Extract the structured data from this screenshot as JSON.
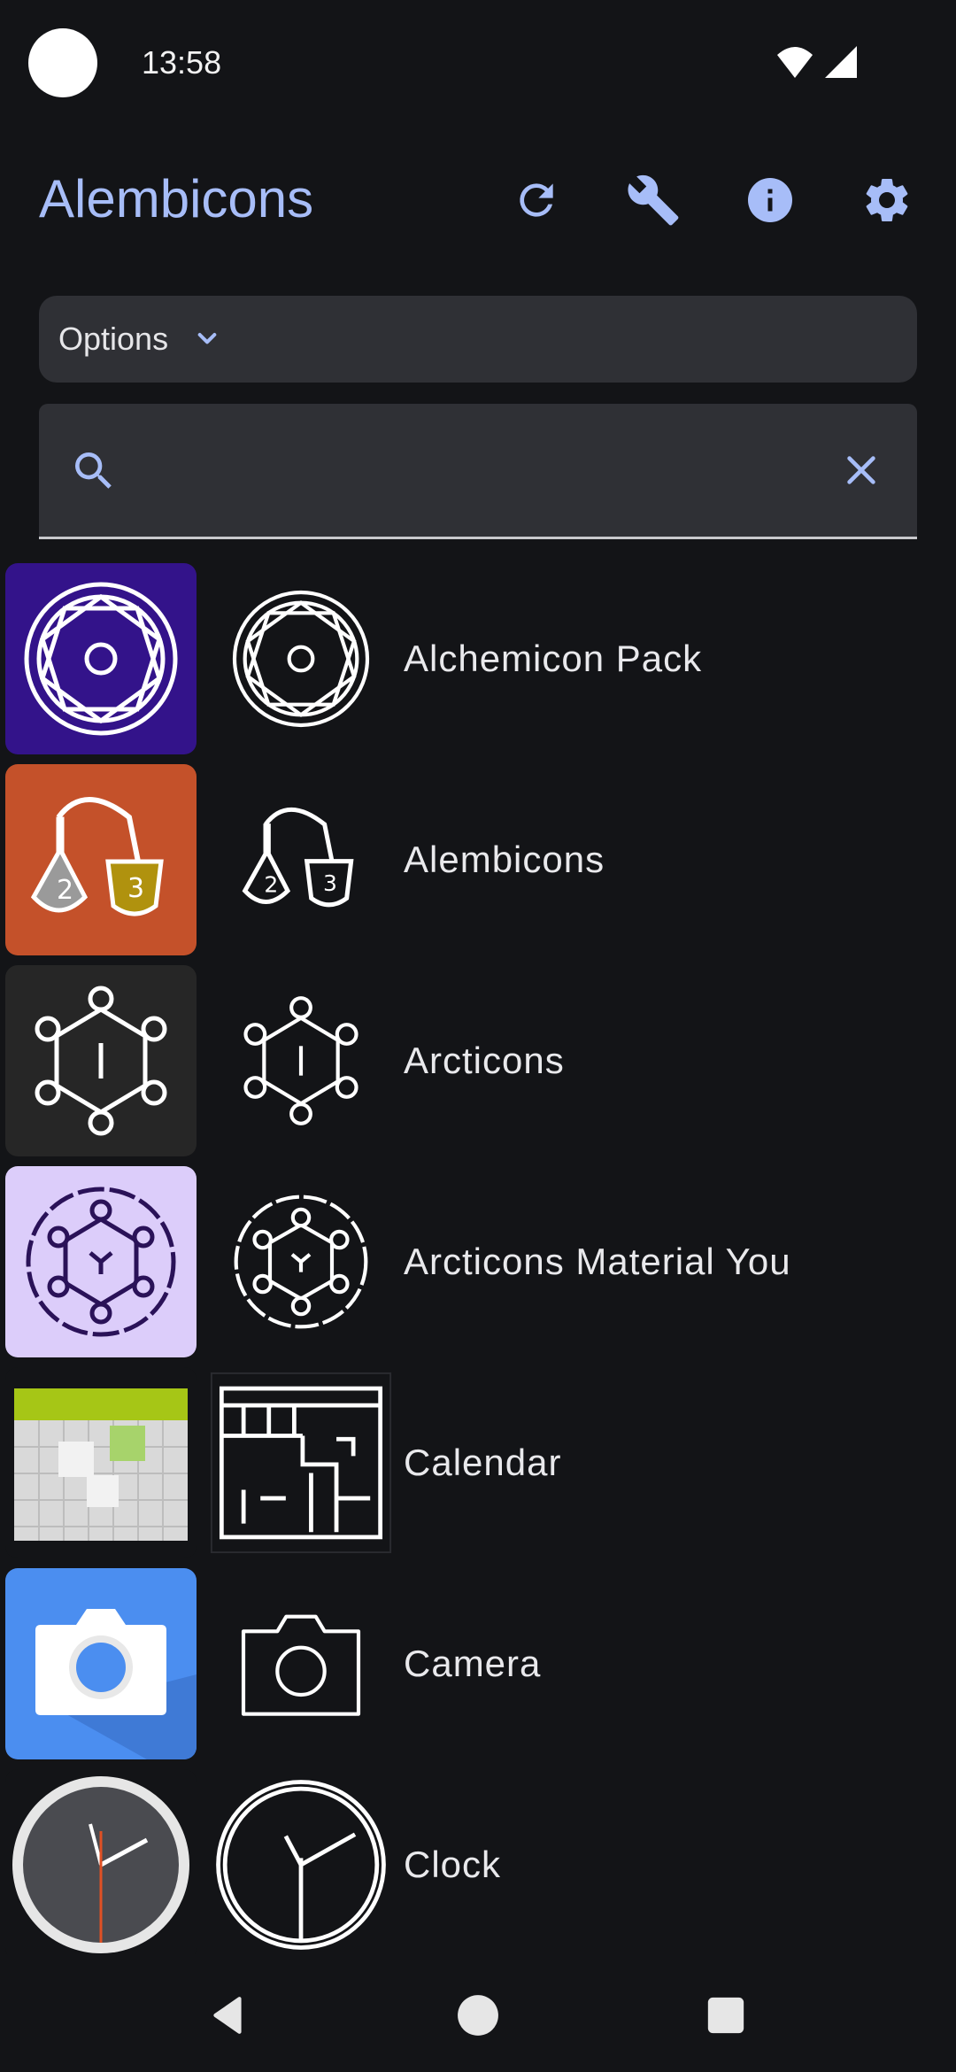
{
  "status": {
    "time": "13:58"
  },
  "app_bar": {
    "title": "Alembicons",
    "actions": [
      "refresh-icon",
      "wrench-icon",
      "info-icon",
      "settings-icon"
    ]
  },
  "options": {
    "label": "Options"
  },
  "search": {
    "value": "",
    "placeholder": ""
  },
  "colors": {
    "accent": "#a7bdf8",
    "background": "#131417",
    "surface": "#2f3035"
  },
  "apps": [
    {
      "label": "Alchemicon Pack"
    },
    {
      "label": "Alembicons"
    },
    {
      "label": "Arcticons"
    },
    {
      "label": "Arcticons Material You"
    },
    {
      "label": "Calendar"
    },
    {
      "label": "Camera"
    },
    {
      "label": "Clock"
    }
  ],
  "nav": {
    "buttons": [
      "back-icon",
      "home-icon",
      "recents-icon"
    ]
  }
}
